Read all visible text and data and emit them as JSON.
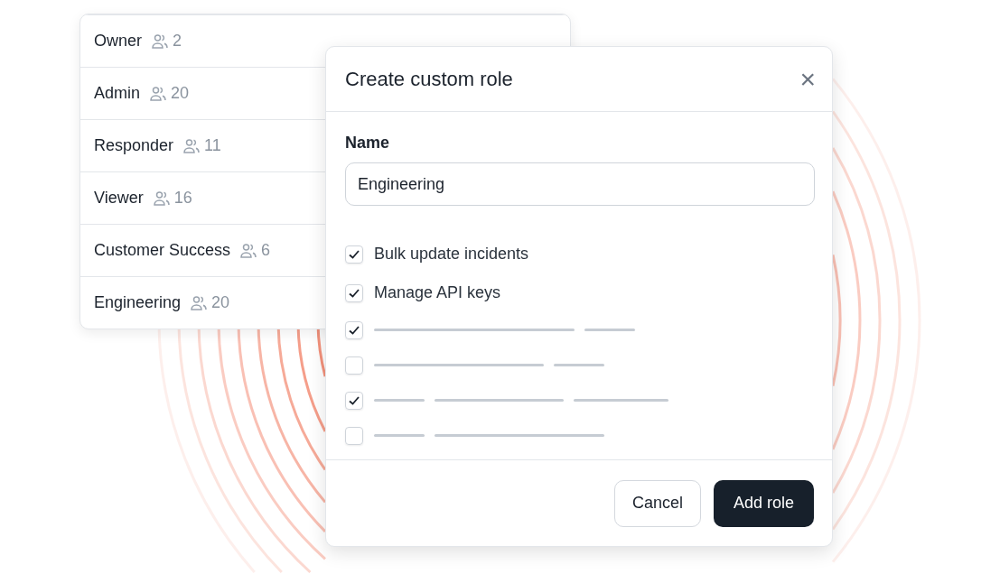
{
  "roles": [
    {
      "name": "Owner",
      "members": "2"
    },
    {
      "name": "Admin",
      "members": "20"
    },
    {
      "name": "Responder",
      "members": "11"
    },
    {
      "name": "Viewer",
      "members": "16"
    },
    {
      "name": "Customer Success",
      "members": "6"
    },
    {
      "name": "Engineering",
      "members": "20"
    }
  ],
  "dialog": {
    "title": "Create custom role",
    "close": "×",
    "name_label": "Name",
    "name_value": "Engineering",
    "permissions": [
      {
        "kind": "text",
        "label": "Bulk update incidents",
        "checked": true
      },
      {
        "kind": "text",
        "label": "Manage API keys",
        "checked": true
      },
      {
        "kind": "skeleton",
        "checked": true
      },
      {
        "kind": "skeleton",
        "checked": false
      },
      {
        "kind": "skeleton",
        "checked": true
      },
      {
        "kind": "skeleton",
        "checked": false
      }
    ],
    "buttons": [
      {
        "label": "Cancel",
        "kind": "secondary"
      },
      {
        "label": "Add role",
        "kind": "primary"
      }
    ]
  }
}
